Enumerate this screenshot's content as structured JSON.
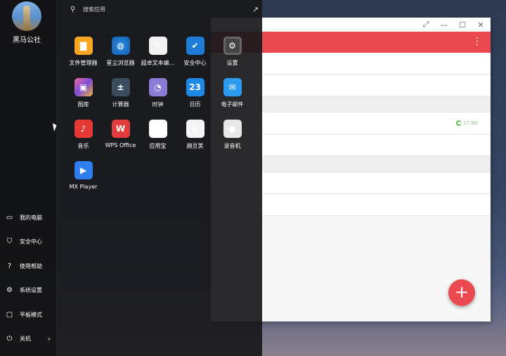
{
  "user": {
    "name": "黑马公社"
  },
  "search": {
    "placeholder": "搜索应用"
  },
  "apps": [
    {
      "label": "文件管理器",
      "icon": "folder-icon",
      "glyph": "▇"
    },
    {
      "label": "星尘浏览器",
      "icon": "globe-icon",
      "glyph": "◍"
    },
    {
      "label": "超卓文本编...",
      "icon": "pen-icon",
      "glyph": "✎"
    },
    {
      "label": "安全中心",
      "icon": "shield-icon",
      "glyph": "✔"
    },
    {
      "label": "设置",
      "icon": "gear-icon",
      "glyph": "⚙"
    },
    {
      "label": "图库",
      "icon": "picture-icon",
      "glyph": "▣"
    },
    {
      "label": "计算器",
      "icon": "calculator-icon",
      "glyph": "±"
    },
    {
      "label": "时钟",
      "icon": "clock-icon",
      "glyph": "◔"
    },
    {
      "label": "日历",
      "icon": "calendar-icon",
      "glyph": "23"
    },
    {
      "label": "电子邮件",
      "icon": "envelope-icon",
      "glyph": "✉"
    },
    {
      "label": "音乐",
      "icon": "music-note-icon",
      "glyph": "♪"
    },
    {
      "label": "WPS Office",
      "icon": "wps-w-icon",
      "glyph": "W"
    },
    {
      "label": "应用宝",
      "icon": "app-store-icon",
      "glyph": "✿"
    },
    {
      "label": "豌豆荚",
      "icon": "pea-pod-icon",
      "glyph": "❦"
    },
    {
      "label": "录音机",
      "icon": "microphone-icon",
      "glyph": "●"
    },
    {
      "label": "MX Player",
      "icon": "play-icon",
      "glyph": "▶"
    }
  ],
  "side_menu": [
    {
      "label": "我的电脑",
      "icon": "folder-icon",
      "glyph": "▭"
    },
    {
      "label": "安全中心",
      "icon": "shield-icon",
      "glyph": "⛉"
    },
    {
      "label": "使用帮助",
      "icon": "help-icon",
      "glyph": "?"
    },
    {
      "label": "系统设置",
      "icon": "gear-icon",
      "glyph": "⚙"
    },
    {
      "label": "平板模式",
      "icon": "tablet-icon",
      "glyph": "▢"
    },
    {
      "label": "关机",
      "icon": "power-icon",
      "glyph": "⏻"
    }
  ],
  "wps_window": {
    "size_label": "27.9G",
    "fab_glyph": "+",
    "controls": [
      "⤢",
      "—",
      "☐",
      "✕"
    ]
  },
  "colors": {
    "accent": "#ea4a4f",
    "menu_bg": "#18181a"
  }
}
